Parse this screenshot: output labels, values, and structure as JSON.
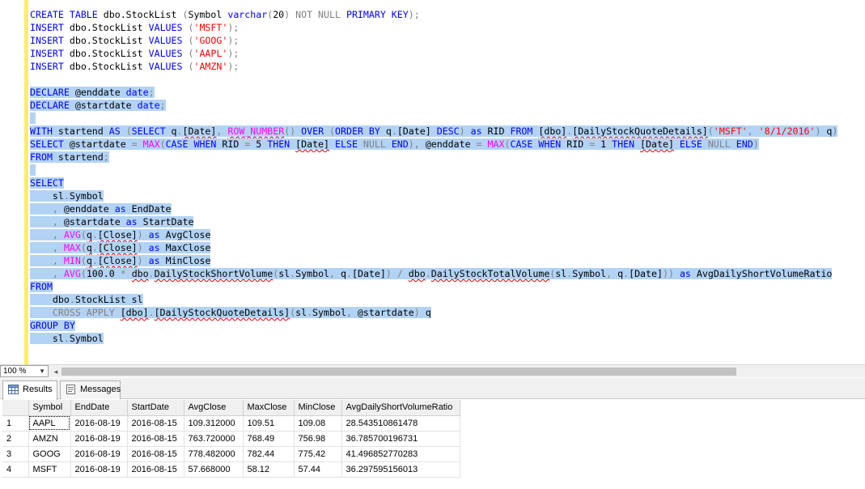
{
  "editor": {
    "lines": [
      {
        "sel": false,
        "tokens": [
          [
            "CREATE TABLE ",
            "kw"
          ],
          [
            "dbo.StockList ",
            ""
          ],
          [
            "(",
            "gray"
          ],
          [
            "Symbol ",
            ""
          ],
          [
            "varchar",
            "kw"
          ],
          [
            "(",
            "gray"
          ],
          [
            "20",
            ""
          ],
          [
            ")",
            "gray"
          ],
          [
            " NOT NULL ",
            "gray"
          ],
          [
            "PRIMARY KEY",
            "kw"
          ],
          [
            ");",
            "gray"
          ]
        ]
      },
      {
        "sel": false,
        "tokens": [
          [
            "INSERT ",
            "kw"
          ],
          [
            "dbo.StockList ",
            ""
          ],
          [
            "VALUES ",
            "kw"
          ],
          [
            "(",
            "gray"
          ],
          [
            "'MSFT'",
            "str"
          ],
          [
            ");",
            "gray"
          ]
        ]
      },
      {
        "sel": false,
        "tokens": [
          [
            "INSERT ",
            "kw"
          ],
          [
            "dbo.StockList ",
            ""
          ],
          [
            "VALUES ",
            "kw"
          ],
          [
            "(",
            "gray"
          ],
          [
            "'GOOG'",
            "str"
          ],
          [
            ");",
            "gray"
          ]
        ]
      },
      {
        "sel": false,
        "tokens": [
          [
            "INSERT ",
            "kw"
          ],
          [
            "dbo.StockList ",
            ""
          ],
          [
            "VALUES ",
            "kw"
          ],
          [
            "(",
            "gray"
          ],
          [
            "'AAPL'",
            "str"
          ],
          [
            ");",
            "gray"
          ]
        ]
      },
      {
        "sel": false,
        "tokens": [
          [
            "INSERT ",
            "kw"
          ],
          [
            "dbo.StockList ",
            ""
          ],
          [
            "VALUES ",
            "kw"
          ],
          [
            "(",
            "gray"
          ],
          [
            "'AMZN'",
            "str"
          ],
          [
            ");",
            "gray"
          ]
        ]
      },
      {
        "sel": false,
        "tokens": []
      },
      {
        "sel": true,
        "tokens": [
          [
            "DECLARE ",
            "kw"
          ],
          [
            "@enddate ",
            ""
          ],
          [
            "date",
            "kw"
          ],
          [
            ";",
            "gray"
          ]
        ]
      },
      {
        "sel": true,
        "tokens": [
          [
            "DECLARE ",
            "kw"
          ],
          [
            "@startdate ",
            ""
          ],
          [
            "date",
            "kw"
          ],
          [
            ";",
            "gray"
          ]
        ]
      },
      {
        "sel": true,
        "tokens": [
          [
            " ",
            ""
          ]
        ]
      },
      {
        "sel": true,
        "tokens": [
          [
            "WITH ",
            "kw"
          ],
          [
            "startend ",
            ""
          ],
          [
            "AS ",
            "kw"
          ],
          [
            "(",
            "gray"
          ],
          [
            "SELECT ",
            "kw"
          ],
          [
            "q",
            ""
          ],
          [
            ".",
            "gray"
          ],
          [
            "[Date]",
            "sq"
          ],
          [
            ", ",
            "gray"
          ],
          [
            "ROW_NUMBER",
            "fn sq"
          ],
          [
            "() ",
            "gray"
          ],
          [
            "OVER ",
            "kw"
          ],
          [
            "(",
            "gray"
          ],
          [
            "ORDER BY ",
            "kw"
          ],
          [
            "q",
            ""
          ],
          [
            ".",
            "gray"
          ],
          [
            "[Date] ",
            ""
          ],
          [
            "DESC",
            "kw"
          ],
          [
            ") ",
            "gray"
          ],
          [
            "as ",
            "kw"
          ],
          [
            "RID ",
            ""
          ],
          [
            "FROM ",
            "kw"
          ],
          [
            "[dbo]",
            "sq"
          ],
          [
            ".",
            "gray"
          ],
          [
            "[DailyStockQuoteDetails]",
            "sq"
          ],
          [
            "(",
            "gray"
          ],
          [
            "'MSFT'",
            "str"
          ],
          [
            ", ",
            "gray"
          ],
          [
            "'8/1/2016'",
            "str"
          ],
          [
            ") ",
            "gray"
          ],
          [
            "q",
            ""
          ],
          [
            ")",
            "gray"
          ]
        ]
      },
      {
        "sel": true,
        "tokens": [
          [
            "SELECT ",
            "kw"
          ],
          [
            "@startdate ",
            ""
          ],
          [
            "= ",
            "gray"
          ],
          [
            "MAX",
            "fn"
          ],
          [
            "(",
            "gray"
          ],
          [
            "CASE WHEN ",
            "kw"
          ],
          [
            "RID ",
            ""
          ],
          [
            "= ",
            "gray"
          ],
          [
            "5 ",
            ""
          ],
          [
            "THEN ",
            "kw"
          ],
          [
            "[Date]",
            "sq"
          ],
          [
            " ELSE ",
            "kw"
          ],
          [
            "NULL ",
            "gray"
          ],
          [
            "END",
            "kw"
          ],
          [
            "), ",
            "gray"
          ],
          [
            "@enddate ",
            ""
          ],
          [
            "= ",
            "gray"
          ],
          [
            "MAX",
            "fn"
          ],
          [
            "(",
            "gray"
          ],
          [
            "CASE WHEN ",
            "kw"
          ],
          [
            "RID ",
            ""
          ],
          [
            "= ",
            "gray"
          ],
          [
            "1 ",
            ""
          ],
          [
            "THEN ",
            "kw"
          ],
          [
            "[Date]",
            "sq"
          ],
          [
            " ELSE ",
            "kw"
          ],
          [
            "NULL ",
            "gray"
          ],
          [
            "END",
            "kw"
          ],
          [
            ")",
            "gray"
          ]
        ]
      },
      {
        "sel": true,
        "tokens": [
          [
            "FROM ",
            "kw"
          ],
          [
            "startend",
            ""
          ],
          [
            ";",
            "gray"
          ]
        ]
      },
      {
        "sel": true,
        "tokens": [
          [
            " ",
            ""
          ]
        ]
      },
      {
        "sel": true,
        "tokens": [
          [
            "SELECT",
            "kw"
          ]
        ]
      },
      {
        "sel": true,
        "tokens": [
          [
            "    sl",
            ""
          ],
          [
            ".",
            "gray"
          ],
          [
            "Symbol",
            ""
          ]
        ]
      },
      {
        "sel": true,
        "tokens": [
          [
            "    , ",
            "gray"
          ],
          [
            "@enddate ",
            ""
          ],
          [
            "as ",
            "kw"
          ],
          [
            "EndDate",
            ""
          ]
        ]
      },
      {
        "sel": true,
        "tokens": [
          [
            "    , ",
            "gray"
          ],
          [
            "@startdate ",
            ""
          ],
          [
            "as ",
            "kw"
          ],
          [
            "StartDate",
            ""
          ]
        ]
      },
      {
        "sel": true,
        "tokens": [
          [
            "    , ",
            "gray"
          ],
          [
            "AVG",
            "fn"
          ],
          [
            "(",
            "gray"
          ],
          [
            "q",
            "sq"
          ],
          [
            ".",
            "gray"
          ],
          [
            "[Close]",
            "sq"
          ],
          [
            ") ",
            "gray"
          ],
          [
            "as ",
            "kw"
          ],
          [
            "AvgClose",
            ""
          ]
        ]
      },
      {
        "sel": true,
        "tokens": [
          [
            "    , ",
            "gray"
          ],
          [
            "MAX",
            "fn"
          ],
          [
            "(",
            "gray"
          ],
          [
            "q",
            "sq"
          ],
          [
            ".",
            "gray"
          ],
          [
            "[Close]",
            "sq"
          ],
          [
            ") ",
            "gray"
          ],
          [
            "as ",
            "kw"
          ],
          [
            "MaxClose",
            ""
          ]
        ]
      },
      {
        "sel": true,
        "tokens": [
          [
            "    , ",
            "gray"
          ],
          [
            "MIN",
            "fn"
          ],
          [
            "(",
            "gray"
          ],
          [
            "q",
            "sq"
          ],
          [
            ".",
            "gray"
          ],
          [
            "[Close]",
            "sq"
          ],
          [
            ") ",
            "gray"
          ],
          [
            "as ",
            "kw"
          ],
          [
            "MinClose",
            ""
          ]
        ]
      },
      {
        "sel": true,
        "tokens": [
          [
            "    , ",
            "gray"
          ],
          [
            "AVG",
            "fn"
          ],
          [
            "(",
            "gray"
          ],
          [
            "100.0 ",
            ""
          ],
          [
            "* ",
            "gray"
          ],
          [
            "dbo",
            "sq"
          ],
          [
            ".",
            "gray"
          ],
          [
            "DailyStockShortVolume",
            "sq"
          ],
          [
            "(",
            "gray"
          ],
          [
            "sl",
            ""
          ],
          [
            ".",
            "gray"
          ],
          [
            "Symbol",
            ""
          ],
          [
            ", ",
            "gray"
          ],
          [
            "q",
            ""
          ],
          [
            ".",
            "gray"
          ],
          [
            "[Date]",
            ""
          ],
          [
            ") / ",
            "gray"
          ],
          [
            "dbo",
            "sq"
          ],
          [
            ".",
            "gray"
          ],
          [
            "DailyStockTotalVolume",
            "sq"
          ],
          [
            "(",
            "gray"
          ],
          [
            "sl",
            ""
          ],
          [
            ".",
            "gray"
          ],
          [
            "Symbol",
            ""
          ],
          [
            ", ",
            "gray"
          ],
          [
            "q",
            ""
          ],
          [
            ".",
            "gray"
          ],
          [
            "[Date]",
            ""
          ],
          [
            ")) ",
            "gray"
          ],
          [
            "as ",
            "kw"
          ],
          [
            "AvgDailyShortVolumeRatio",
            ""
          ]
        ]
      },
      {
        "sel": true,
        "tokens": [
          [
            "FROM",
            "kw"
          ]
        ]
      },
      {
        "sel": true,
        "tokens": [
          [
            "    dbo",
            ""
          ],
          [
            ".",
            "gray"
          ],
          [
            "StockList ",
            ""
          ],
          [
            "sl",
            ""
          ]
        ]
      },
      {
        "sel": true,
        "tokens": [
          [
            "    ",
            ""
          ],
          [
            "CROSS APPLY ",
            "gray"
          ],
          [
            "[dbo]",
            "sq"
          ],
          [
            ".",
            "gray"
          ],
          [
            "[DailyStockQuoteDetails]",
            "sq"
          ],
          [
            "(",
            "gray"
          ],
          [
            "sl",
            ""
          ],
          [
            ".",
            "gray"
          ],
          [
            "Symbol",
            ""
          ],
          [
            ", ",
            "gray"
          ],
          [
            "@startdate",
            ""
          ],
          [
            ") ",
            "gray"
          ],
          [
            "q",
            ""
          ]
        ]
      },
      {
        "sel": true,
        "tokens": [
          [
            "GROUP BY",
            "kw"
          ]
        ]
      },
      {
        "sel": true,
        "tokens": [
          [
            "    sl",
            ""
          ],
          [
            ".",
            "gray"
          ],
          [
            "Symbol",
            ""
          ]
        ]
      }
    ]
  },
  "zoom": {
    "value": "100 %",
    "arrow": "▼"
  },
  "tabs": {
    "results": "Results",
    "messages": "Messages"
  },
  "grid": {
    "columns": [
      "Symbol",
      "EndDate",
      "StartDate",
      "AvgClose",
      "MaxClose",
      "MinClose",
      "AvgDailyShortVolumeRatio"
    ],
    "rows": [
      {
        "n": "1",
        "cells": [
          "AAPL",
          "2016-08-19",
          "2016-08-15",
          "109.312000",
          "109.51",
          "109.08",
          "28.543510861478"
        ]
      },
      {
        "n": "2",
        "cells": [
          "AMZN",
          "2016-08-19",
          "2016-08-15",
          "763.720000",
          "768.49",
          "756.98",
          "36.785700196731"
        ]
      },
      {
        "n": "3",
        "cells": [
          "GOOG",
          "2016-08-19",
          "2016-08-15",
          "778.482000",
          "782.44",
          "775.42",
          "41.496852770283"
        ]
      },
      {
        "n": "4",
        "cells": [
          "MSFT",
          "2016-08-19",
          "2016-08-15",
          "57.668000",
          "58.12",
          "57.44",
          "36.297595156013"
        ]
      }
    ]
  },
  "colors": {
    "selection": "#b3d3f5",
    "keyword": "#0000ff",
    "string": "#ff0000",
    "function": "#ff00ff",
    "gray": "#808080",
    "change_bar": "#ffee62"
  }
}
